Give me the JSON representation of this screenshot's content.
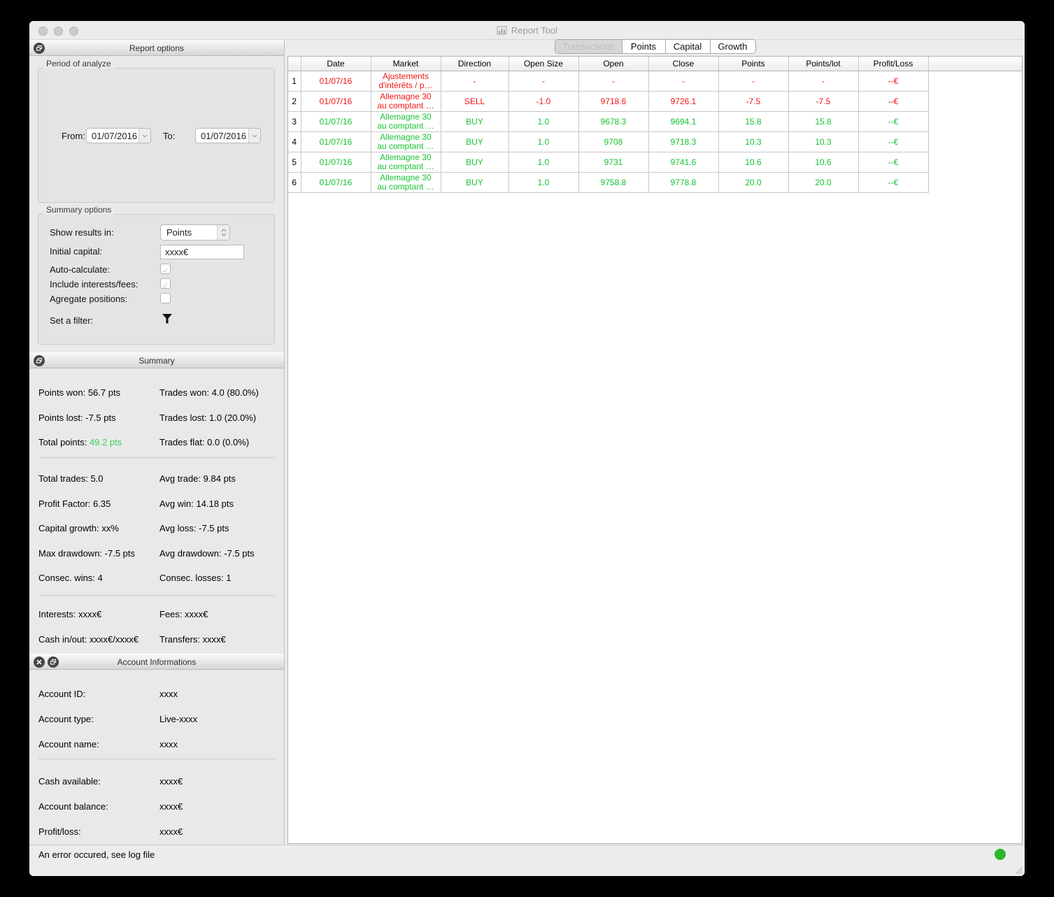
{
  "window": {
    "title": "Report Tool"
  },
  "tabs": {
    "items": [
      {
        "label": "Transactions"
      },
      {
        "label": "Points"
      },
      {
        "label": "Capital"
      },
      {
        "label": "Growth"
      }
    ]
  },
  "report_options": {
    "header": "Report options",
    "period": {
      "group_label": "Period of analyze",
      "from_label": "From:",
      "from_value": "01/07/2016",
      "to_label": "To:",
      "to_value": "01/07/2016"
    },
    "summary_options": {
      "group_label": "Summary options",
      "show_results_label": "Show results in:",
      "show_results_value": "Points",
      "initial_capital_label": "Initial capital:",
      "initial_capital_value": "xxxx€",
      "auto_calculate_label": "Auto-calculate:",
      "include_fees_label": "Include interests/fees:",
      "agregate_label": "Agregate positions:",
      "filter_label": "Set a filter:"
    }
  },
  "summary": {
    "header": "Summary",
    "rows": [
      {
        "left_label": "Points won:",
        "left_value": "56.7 pts",
        "right_label": "Trades won:",
        "right_value": "4.0 (80.0%)"
      },
      {
        "left_label": "Points lost:",
        "left_value": "-7.5 pts",
        "right_label": "Trades lost:",
        "right_value": "1.0 (20.0%)"
      },
      {
        "left_label": "Total points:",
        "left_value": "49.2 pts",
        "right_label": "Trades flat:",
        "right_value": "0.0 (0.0%)"
      },
      {
        "left_label": "Total trades:",
        "left_value": "5.0",
        "right_label": "Avg trade:",
        "right_value": "9.84 pts"
      },
      {
        "left_label": "Profit Factor:",
        "left_value": "6.35",
        "right_label": "Avg win:",
        "right_value": "14.18 pts"
      },
      {
        "left_label": "Capital growth:",
        "left_value": "xx%",
        "right_label": "Avg loss:",
        "right_value": "-7.5 pts"
      },
      {
        "left_label": "Max drawdown:",
        "left_value": "-7.5 pts",
        "right_label": "Avg drawdown:",
        "right_value": "-7.5 pts"
      },
      {
        "left_label": "Consec. wins:",
        "left_value": "4",
        "right_label": "Consec. losses:",
        "right_value": "1"
      },
      {
        "left_label": "Interests:",
        "left_value": "xxxx€",
        "right_label": "Fees:",
        "right_value": "xxxx€"
      },
      {
        "left_label": "Cash in/out:",
        "left_value": "xxxx€/xxxx€",
        "right_label": "Transfers:",
        "right_value": "xxxx€"
      }
    ]
  },
  "account": {
    "header": "Account Informations",
    "rows": [
      {
        "label": "Account ID:",
        "value": "xxxx"
      },
      {
        "label": "Account type:",
        "value": "Live-xxxx"
      },
      {
        "label": "Account name:",
        "value": "xxxx"
      },
      {
        "label": "Cash available:",
        "value": "xxxx€"
      },
      {
        "label": "Account balance:",
        "value": "xxxx€"
      },
      {
        "label": "Profit/loss:",
        "value": "xxxx€"
      }
    ]
  },
  "table": {
    "columns": [
      "Date",
      "Market",
      "Direction",
      "Open Size",
      "Open",
      "Close",
      "Points",
      "Points/lot",
      "Profit/Loss"
    ],
    "rows": [
      {
        "num": "1",
        "date": "01/07/16",
        "market_l1": "Ajustements",
        "market_l2": "d'intérêts / p…",
        "direction": "-",
        "open_size": "-",
        "open": "-",
        "close": "-",
        "points": "-",
        "points_lot": "-",
        "profit_loss": "--€",
        "trend": "loss"
      },
      {
        "num": "2",
        "date": "01/07/16",
        "market_l1": "Allemagne 30",
        "market_l2": "au comptant …",
        "direction": "SELL",
        "open_size": "-1.0",
        "open": "9718.6",
        "close": "9726.1",
        "points": "-7.5",
        "points_lot": "-7.5",
        "profit_loss": "--€",
        "trend": "loss"
      },
      {
        "num": "3",
        "date": "01/07/16",
        "market_l1": "Allemagne 30",
        "market_l2": "au comptant …",
        "direction": "BUY",
        "open_size": "1.0",
        "open": "9678.3",
        "close": "9694.1",
        "points": "15.8",
        "points_lot": "15.8",
        "profit_loss": "--€",
        "trend": "gain"
      },
      {
        "num": "4",
        "date": "01/07/16",
        "market_l1": "Allemagne 30",
        "market_l2": "au comptant …",
        "direction": "BUY",
        "open_size": "1.0",
        "open": "9708",
        "close": "9718.3",
        "points": "10.3",
        "points_lot": "10.3",
        "profit_loss": "--€",
        "trend": "gain"
      },
      {
        "num": "5",
        "date": "01/07/16",
        "market_l1": "Allemagne 30",
        "market_l2": "au comptant …",
        "direction": "BUY",
        "open_size": "1.0",
        "open": "9731",
        "close": "9741.6",
        "points": "10.6",
        "points_lot": "10.6",
        "profit_loss": "--€",
        "trend": "gain"
      },
      {
        "num": "6",
        "date": "01/07/16",
        "market_l1": "Allemagne 30",
        "market_l2": "au comptant …",
        "direction": "BUY",
        "open_size": "1.0",
        "open": "9758.8",
        "close": "9778.8",
        "points": "20.0",
        "points_lot": "20.0",
        "profit_loss": "--€",
        "trend": "gain"
      }
    ]
  },
  "status": {
    "message": "An error occured, see log file"
  },
  "colors": {
    "loss_text": "#f01515",
    "gain_text": "#17c332",
    "total_points_green": "#3dd35b",
    "status_dot_green": "#2db52d"
  }
}
